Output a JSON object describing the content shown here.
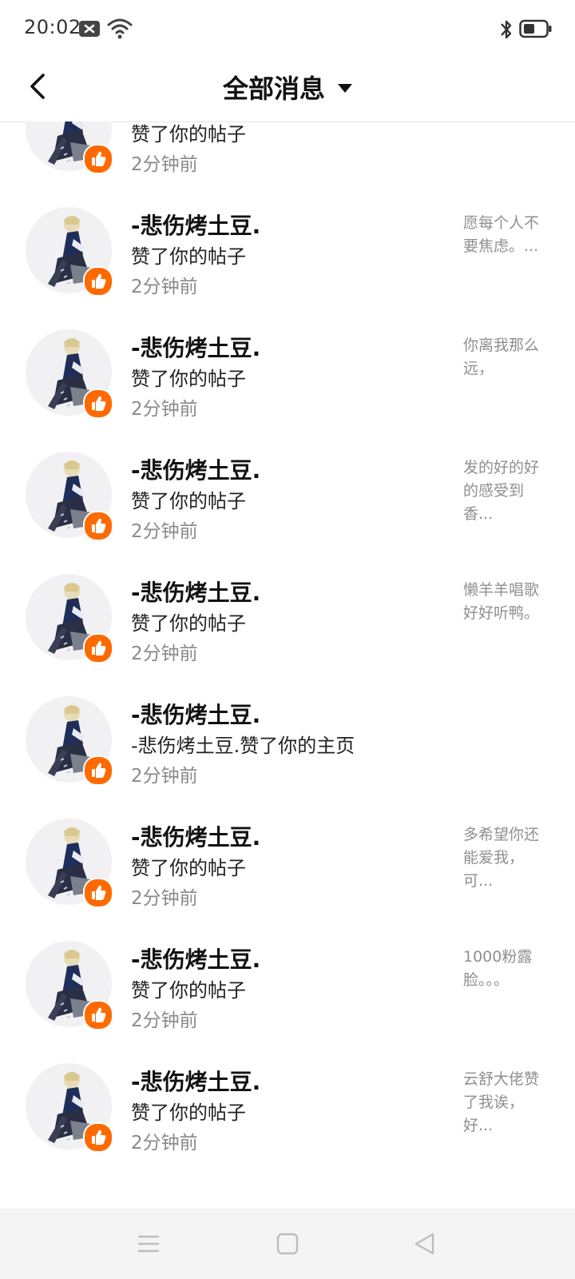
{
  "status_bar": {
    "time": "20:02"
  },
  "header": {
    "title": "全部消息"
  },
  "rows": [
    {
      "name": "",
      "action": "赞了你的帖子",
      "time": "2分钟前",
      "preview": ""
    },
    {
      "name": "-悲伤烤土豆.",
      "action": "赞了你的帖子",
      "time": "2分钟前",
      "preview": "愿每个人不要焦虑。..."
    },
    {
      "name": "-悲伤烤土豆.",
      "action": "赞了你的帖子",
      "time": "2分钟前",
      "preview": "你离我那么远，"
    },
    {
      "name": "-悲伤烤土豆.",
      "action": "赞了你的帖子",
      "time": "2分钟前",
      "preview": "发的好的好的感受到香..."
    },
    {
      "name": "-悲伤烤土豆.",
      "action": "赞了你的帖子",
      "time": "2分钟前",
      "preview": "懒羊羊唱歌好好听鸭。"
    },
    {
      "name": "-悲伤烤土豆.",
      "action": "-悲伤烤土豆.赞了你的主页",
      "time": "2分钟前",
      "preview": ""
    },
    {
      "name": "-悲伤烤土豆.",
      "action": "赞了你的帖子",
      "time": "2分钟前",
      "preview": "多希望你还能爱我，可..."
    },
    {
      "name": "-悲伤烤土豆.",
      "action": "赞了你的帖子",
      "time": "2分钟前",
      "preview": "1000粉露脸。。。"
    },
    {
      "name": "-悲伤烤土豆.",
      "action": "赞了你的帖子",
      "time": "2分钟前",
      "preview": "云舒大佬赞了我诶，好..."
    }
  ],
  "colors": {
    "accent": "#ff6a00",
    "secondary_text": "#8a8a8a"
  },
  "icons": {
    "back": "back-arrow-icon",
    "dropdown": "caret-down-icon",
    "like": "thumbs-up-icon",
    "nav_menu": "menu-icon",
    "nav_home": "home-square-icon",
    "nav_back": "back-triangle-icon"
  }
}
